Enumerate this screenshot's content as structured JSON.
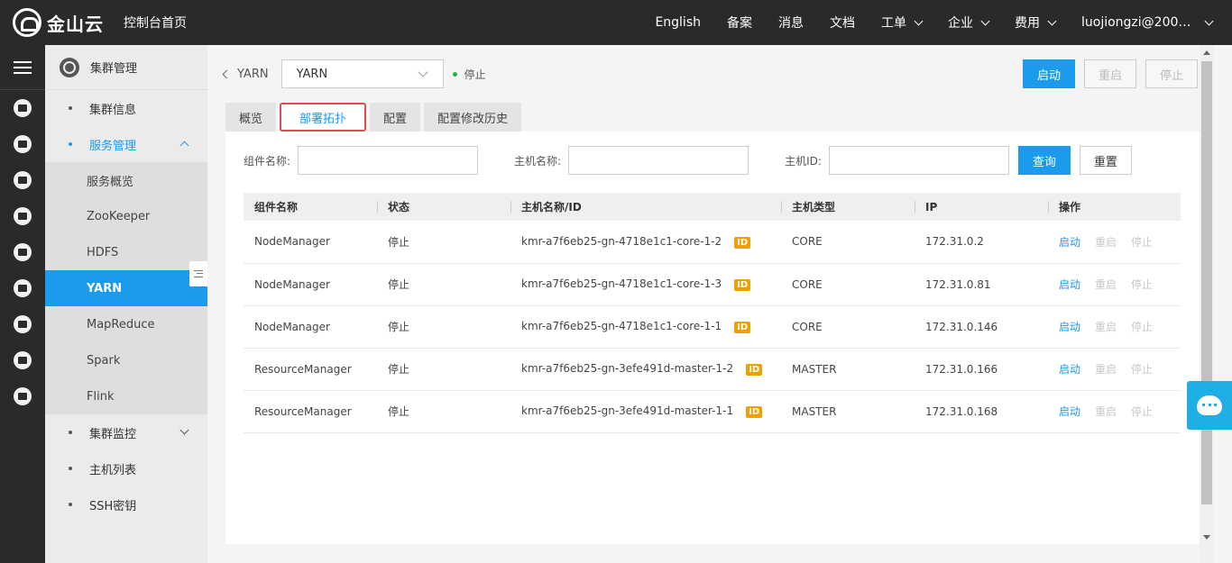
{
  "topbar": {
    "brand": "金山云",
    "console_home": "控制台首页",
    "nav": {
      "english": "English",
      "beian": "备案",
      "messages": "消息",
      "docs": "文档",
      "tickets": "工单",
      "enterprise": "企业",
      "billing": "费用",
      "user": "luojiongzi@20000..."
    }
  },
  "sidebar": {
    "header": "集群管理",
    "items": [
      {
        "label": "集群信息"
      },
      {
        "label": "服务管理"
      },
      {
        "label": "集群监控"
      },
      {
        "label": "主机列表"
      },
      {
        "label": "SSH密钥"
      }
    ],
    "services": [
      "服务概览",
      "ZooKeeper",
      "HDFS",
      "YARN",
      "MapReduce",
      "Spark",
      "Flink"
    ]
  },
  "main": {
    "back_label": "YARN",
    "service_select": "YARN",
    "status": "停止",
    "buttons": {
      "start": "启动",
      "restart": "重启",
      "stop": "停止"
    },
    "tabs": [
      "概览",
      "部署拓扑",
      "配置",
      "配置修改历史"
    ],
    "filters": {
      "component_label": "组件名称:",
      "host_name_label": "主机名称:",
      "host_id_label": "主机ID:",
      "query": "查询",
      "reset": "重置"
    },
    "table": {
      "columns": [
        "组件名称",
        "状态",
        "主机名称/ID",
        "主机类型",
        "IP",
        "操作"
      ],
      "id_badge": "ID",
      "rows": [
        {
          "component": "NodeManager",
          "status": "停止",
          "host": "kmr-a7f6eb25-gn-4718e1c1-core-1-2",
          "type": "CORE",
          "ip": "172.31.0.2"
        },
        {
          "component": "NodeManager",
          "status": "停止",
          "host": "kmr-a7f6eb25-gn-4718e1c1-core-1-3",
          "type": "CORE",
          "ip": "172.31.0.81"
        },
        {
          "component": "NodeManager",
          "status": "停止",
          "host": "kmr-a7f6eb25-gn-4718e1c1-core-1-1",
          "type": "CORE",
          "ip": "172.31.0.146"
        },
        {
          "component": "ResourceManager",
          "status": "停止",
          "host": "kmr-a7f6eb25-gn-3efe491d-master-1-2",
          "type": "MASTER",
          "ip": "172.31.0.166"
        },
        {
          "component": "ResourceManager",
          "status": "停止",
          "host": "kmr-a7f6eb25-gn-3efe491d-master-1-1",
          "type": "MASTER",
          "ip": "172.31.0.168"
        }
      ],
      "actions": {
        "start": "启动",
        "restart": "重启",
        "stop": "停止"
      }
    }
  },
  "colors": {
    "accent": "#1a9bec",
    "topbar": "#2a2a2a",
    "badge": "#f0a000",
    "running_dot": "#21b24b",
    "tab_highlight": "#e04d4d"
  }
}
